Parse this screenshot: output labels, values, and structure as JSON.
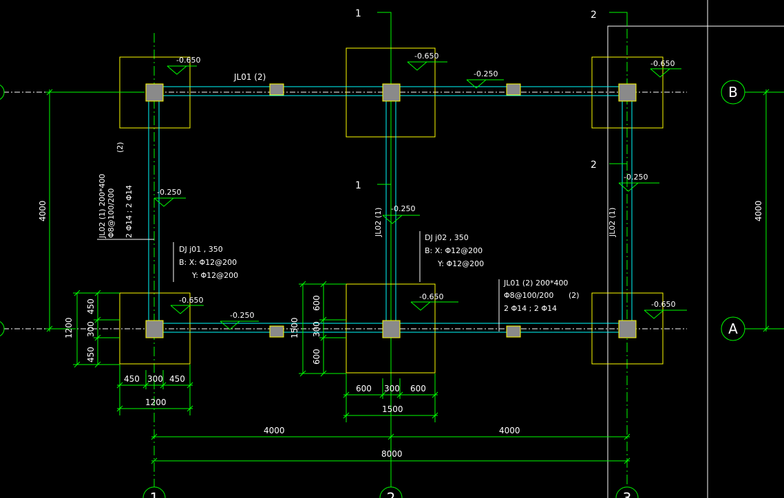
{
  "colors": {
    "background": "#000000",
    "axis": "#00ff00",
    "beam": "#00ffff",
    "footing": "#ffff00",
    "column": "#808080",
    "text": "#ffffff",
    "frame": "#ffffff"
  },
  "grid": {
    "axes": [
      "1",
      "2",
      "3",
      "A",
      "B"
    ],
    "span_x": [
      "4000",
      "4000"
    ],
    "total_x": "8000",
    "span_y": "4000"
  },
  "footing_types": {
    "dj01": {
      "label": "DJ j01 , 350",
      "x": "B: X: Φ12@200",
      "y": "Y: Φ12@200"
    },
    "dj02": {
      "label": "DJ j02 , 350",
      "x": "B: X: Φ12@200",
      "y": "Y: Φ12@200"
    }
  },
  "beams": {
    "jl01": {
      "name": "JL01 (2)",
      "spec": "JL01 (2) 200*400",
      "stirrup": "Φ8@100/200",
      "spans": "(2)",
      "bars": "2 Φ14 ; 2 Φ14"
    },
    "jl02": {
      "name": "JL02 (1)",
      "spec": "JL02 (1) 200*400",
      "stirrup": "Φ8@100/200",
      "spans": "(2)",
      "bars": "2 Φ14 ; 2 Φ14"
    }
  },
  "elevations": {
    "footing": "-0.650",
    "beam": "-0.250"
  },
  "section_marks": [
    "1",
    "2"
  ],
  "dimensions": {
    "dj01": {
      "parts": [
        "450",
        "300",
        "450"
      ],
      "total": "1200"
    },
    "dj02": {
      "parts": [
        "600",
        "300",
        "600"
      ],
      "total": "1500"
    },
    "left_axis": {
      "parts": [
        "450",
        "300",
        "450"
      ],
      "total": "1200"
    },
    "middle_axis": {
      "parts": [
        "600",
        "300",
        "600"
      ],
      "total": "1500"
    }
  }
}
